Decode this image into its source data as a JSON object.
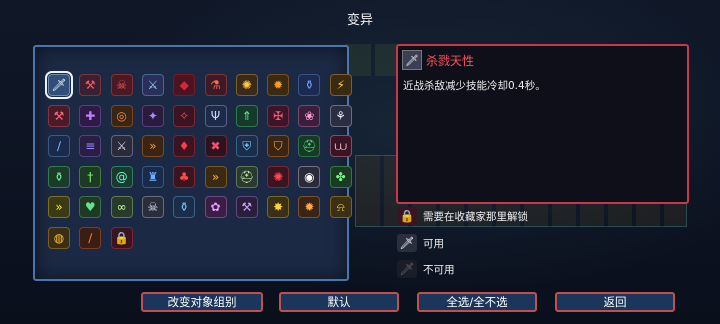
{
  "screen": {
    "title": "变异"
  },
  "mutation_grid": {
    "rows": [
      [
        {
          "icon": "dagger-icon",
          "glyph": "🗡",
          "bg": "#3b3f55",
          "fg": "#ffffff",
          "selected": true
        },
        {
          "icon": "pickaxe-icon",
          "glyph": "⚒",
          "bg": "#3a2030",
          "fg": "#ff5a5a"
        },
        {
          "icon": "skull-swords-icon",
          "glyph": "☠",
          "bg": "#4a1a24",
          "fg": "#ff5a5a"
        },
        {
          "icon": "multi-sword-icon",
          "glyph": "⚔",
          "bg": "#2a2f5a",
          "fg": "#9ad1ff"
        },
        {
          "icon": "red-gem-icon",
          "glyph": "◆",
          "bg": "#4a1420",
          "fg": "#d4283a"
        },
        {
          "icon": "red-vial-icon",
          "glyph": "⚗",
          "bg": "#3d1a26",
          "fg": "#ff6a4a"
        },
        {
          "icon": "rainbow-icon",
          "glyph": "✺",
          "bg": "#3b2a1a",
          "fg": "#ffcc44"
        },
        {
          "icon": "orange-orb-icon",
          "glyph": "✹",
          "bg": "#3a2a14",
          "fg": "#ff9a2a"
        },
        {
          "icon": "blue-potion-icon",
          "glyph": "⚱",
          "bg": "#1c2a52",
          "fg": "#6aa8ff"
        },
        {
          "icon": "lightning-icon",
          "glyph": "⚡",
          "bg": "#3a2a14",
          "fg": "#ffd23a"
        }
      ],
      [
        {
          "icon": "red-hammer-icon",
          "glyph": "⚒",
          "bg": "#4a1a28",
          "fg": "#ff6a7a"
        },
        {
          "icon": "purple-cross-icon",
          "glyph": "✚",
          "bg": "#2e1a44",
          "fg": "#c47cff"
        },
        {
          "icon": "target-ring-icon",
          "glyph": "◎",
          "bg": "#3a2414",
          "fg": "#ff8a2a"
        },
        {
          "icon": "purple-fang-icon",
          "glyph": "✦",
          "bg": "#2a1a3c",
          "fg": "#b088ff"
        },
        {
          "icon": "red-wing-icon",
          "glyph": "✧",
          "bg": "#3a1420",
          "fg": "#ff4a5a"
        },
        {
          "icon": "wishbone-icon",
          "glyph": "Ψ",
          "bg": "#1e2a4a",
          "fg": "#c8d4ff"
        },
        {
          "icon": "green-arrow-icon",
          "glyph": "⇑",
          "bg": "#163a2a",
          "fg": "#5aff9a"
        },
        {
          "icon": "red-shield-icon",
          "glyph": "✠",
          "bg": "#3a1626",
          "fg": "#ff5a7a"
        },
        {
          "icon": "pink-flower-icon",
          "glyph": "❀",
          "bg": "#3a1e3a",
          "fg": "#ff9ad8"
        },
        {
          "icon": "white-boot-icon",
          "glyph": "⚘",
          "bg": "#2a2e44",
          "fg": "#f0f0f0"
        }
      ],
      [
        {
          "icon": "blue-wand-icon",
          "glyph": "∕",
          "bg": "#1a2a4a",
          "fg": "#7ab8ff"
        },
        {
          "icon": "spike-row-icon",
          "glyph": "≡",
          "bg": "#2a1e44",
          "fg": "#a08aff"
        },
        {
          "icon": "crossed-sword-icon",
          "glyph": "⚔",
          "bg": "#2a2a3a",
          "fg": "#d8d8e8"
        },
        {
          "icon": "dash-icon",
          "glyph": "»",
          "bg": "#3a2414",
          "fg": "#ff9a3a"
        },
        {
          "icon": "red-drop-icon",
          "glyph": "♦",
          "bg": "#3a1420",
          "fg": "#ff3a4a"
        },
        {
          "icon": "crossed-skull-icon",
          "glyph": "✖",
          "bg": "#2a1420",
          "fg": "#ff4a6a"
        },
        {
          "icon": "blue-crest-icon",
          "glyph": "⛨",
          "bg": "#1a2e4a",
          "fg": "#7ac8ff"
        },
        {
          "icon": "orange-shield-icon",
          "glyph": "⛉",
          "bg": "#3a2414",
          "fg": "#ffaa3a"
        },
        {
          "icon": "green-helm-icon",
          "glyph": "⛑",
          "bg": "#163a24",
          "fg": "#5ae08a"
        },
        {
          "icon": "fang-mouth-icon",
          "glyph": "⩊",
          "bg": "#3a1424",
          "fg": "#ffd0d0"
        }
      ],
      [
        {
          "icon": "green-bottle-icon",
          "glyph": "⚱",
          "bg": "#1a3a2a",
          "fg": "#6aff9a"
        },
        {
          "icon": "green-sword-icon",
          "glyph": "†",
          "bg": "#1e3a24",
          "fg": "#7aff6a"
        },
        {
          "icon": "green-swirl-icon",
          "glyph": "@",
          "bg": "#1a3a30",
          "fg": "#5affc8"
        },
        {
          "icon": "blue-castle-icon",
          "glyph": "♜",
          "bg": "#1a2a4a",
          "fg": "#6ab0ff"
        },
        {
          "icon": "red-bag-icon",
          "glyph": "♣",
          "bg": "#3a1420",
          "fg": "#ff4a4a"
        },
        {
          "icon": "double-chevron-icon",
          "glyph": "»",
          "bg": "#3a2a14",
          "fg": "#ffb03a"
        },
        {
          "icon": "helmet-icon",
          "glyph": "⛑",
          "bg": "#2a3a30",
          "fg": "#c8f0a0"
        },
        {
          "icon": "red-spiral-icon",
          "glyph": "✺",
          "bg": "#3a1420",
          "fg": "#ff4a5a"
        },
        {
          "icon": "eye-icon",
          "glyph": "◉",
          "bg": "#2a2a3a",
          "fg": "#ffffff"
        },
        {
          "icon": "green-cross-icon",
          "glyph": "✤",
          "bg": "#1a3a24",
          "fg": "#6aff7a"
        }
      ],
      [
        {
          "icon": "fast-forward-icon",
          "glyph": "»",
          "bg": "#3a3a14",
          "fg": "#ffe03a"
        },
        {
          "icon": "green-heart-icon",
          "glyph": "♥",
          "bg": "#1e3a24",
          "fg": "#6ae08a"
        },
        {
          "icon": "goggles-icon",
          "glyph": "∞",
          "bg": "#2a3a2a",
          "fg": "#c8ffa0"
        },
        {
          "icon": "skull-icon",
          "glyph": "☠",
          "bg": "#2a2e3a",
          "fg": "#e0e8ff"
        },
        {
          "icon": "blue-pot-icon",
          "glyph": "⚱",
          "bg": "#1a2e4a",
          "fg": "#7ac8ff"
        },
        {
          "icon": "pink-wisp-icon",
          "glyph": "✿",
          "bg": "#3a1e44",
          "fg": "#e09aff"
        },
        {
          "icon": "battle-axe-icon",
          "glyph": "⚒",
          "bg": "#2a1e3a",
          "fg": "#c8a0ff"
        },
        {
          "icon": "sun-burst-icon",
          "glyph": "✸",
          "bg": "#3a3014",
          "fg": "#ffd23a"
        },
        {
          "icon": "spiked-mace-icon",
          "glyph": "✹",
          "bg": "#3a2414",
          "fg": "#ffaa4a"
        },
        {
          "icon": "gold-bell-icon",
          "glyph": "⍾",
          "bg": "#3a3014",
          "fg": "#ffcc3a"
        }
      ],
      [
        {
          "icon": "gold-ring-icon",
          "glyph": "◍",
          "bg": "#3a2e14",
          "fg": "#ffc23a"
        },
        {
          "icon": "fire-staff-icon",
          "glyph": "∕",
          "bg": "#3a1e14",
          "fg": "#ff7a3a"
        },
        {
          "icon": "red-lock-icon",
          "glyph": "🔒",
          "bg": "#3a1420",
          "fg": "#ff4a5a"
        }
      ]
    ]
  },
  "detail": {
    "icon": "dagger-icon",
    "icon_glyph": "🗡",
    "title": "杀戮天性",
    "description": "近战杀敌减少技能冷却0.4秒。"
  },
  "legend": [
    {
      "icon": "lock-icon",
      "glyph": "🔒",
      "bg": "#3a1420",
      "fg": "#ff5a6a",
      "label": "需要在收藏家那里解锁"
    },
    {
      "icon": "dagger-icon",
      "glyph": "🗡",
      "bg": "#2a2e3e",
      "fg": "#ffffff",
      "label": "可用"
    },
    {
      "icon": "dagger-dim-icon",
      "glyph": "🗡",
      "bg": "#1a1c26",
      "fg": "#666a78",
      "label": "不可用"
    }
  ],
  "buttons": {
    "change_group": "改变对象组别",
    "default": "默认",
    "select_all": "全选/全不选",
    "back": "返回"
  },
  "colors": {
    "panel_border": "#4a76ad",
    "detail_border": "#c8384d",
    "title_red": "#ff4f5f",
    "button_border": "#c0504d",
    "button_bg": "#1c355a"
  }
}
